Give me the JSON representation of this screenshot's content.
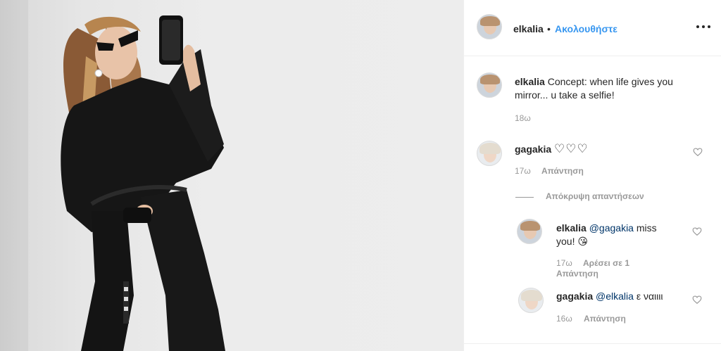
{
  "post": {
    "author": "elkalia",
    "follow_label": "Ακολουθήστε",
    "more_icon": "more-options-icon"
  },
  "caption": {
    "username": "elkalia",
    "text_line1": "Concept: when life gives you",
    "text_line2": "mirror... u take a selfie!",
    "time": "18ω"
  },
  "comments": [
    {
      "username": "gagakia",
      "text": "♡♡♡",
      "time": "17ω",
      "reply_label": "Απάντηση"
    }
  ],
  "replies_toggle": "Απόκρυψη απαντήσεων",
  "replies": [
    {
      "username": "elkalia",
      "mention": "@gagakia",
      "text_a": "miss",
      "text_b": "you! 😘",
      "time": "17ω",
      "likes": "Αρέσει σε 1",
      "reply_label": "Απάντηση"
    },
    {
      "username": "gagakia",
      "mention": "@elkalia",
      "text": "ε ναιιιι",
      "time": "16ω",
      "reply_label": "Απάντηση"
    }
  ],
  "colors": {
    "accent": "#3897f0",
    "mention": "#003569",
    "muted": "#999999",
    "text": "#262626"
  }
}
